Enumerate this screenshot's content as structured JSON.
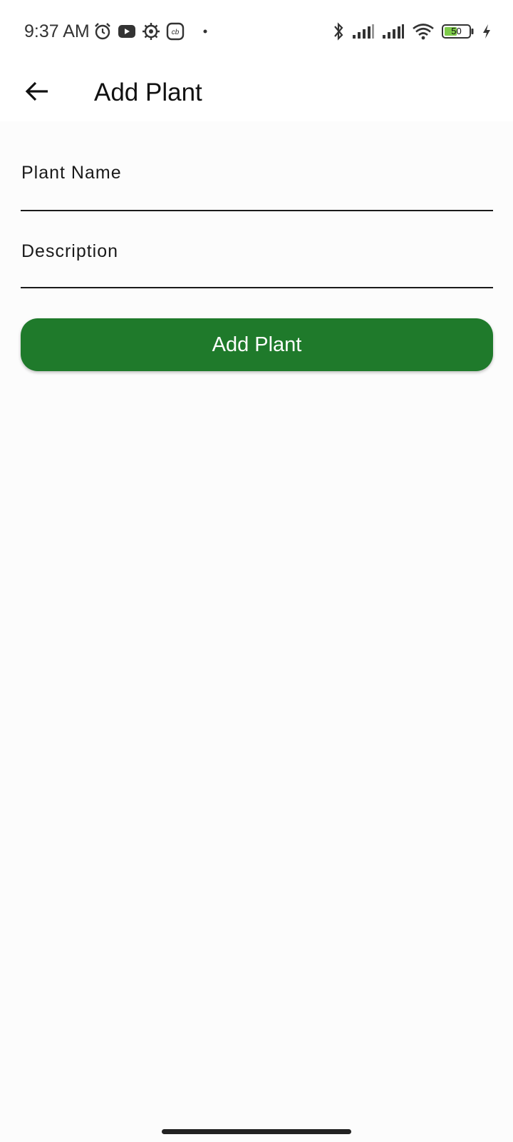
{
  "status_bar": {
    "time": "9:37 AM",
    "left_icons": [
      "alarm-icon",
      "youtube-icon",
      "settings-gear-icon",
      "app-cb-icon",
      "dot-icon"
    ],
    "app_icon_text": "cb",
    "right_icons": [
      "bluetooth-icon",
      "signal-icon",
      "signal-icon",
      "wifi-icon",
      "battery-icon",
      "charging-icon"
    ],
    "battery_level": "50",
    "battery_color": "#7ecb4a"
  },
  "app_bar": {
    "back_icon": "arrow-back-icon",
    "title": "Add Plant"
  },
  "form": {
    "plant_name": {
      "label": "Plant Name",
      "value": ""
    },
    "description": {
      "label": "Description",
      "value": ""
    }
  },
  "actions": {
    "add_label": "Add Plant",
    "add_color": "#1f7a2b"
  }
}
